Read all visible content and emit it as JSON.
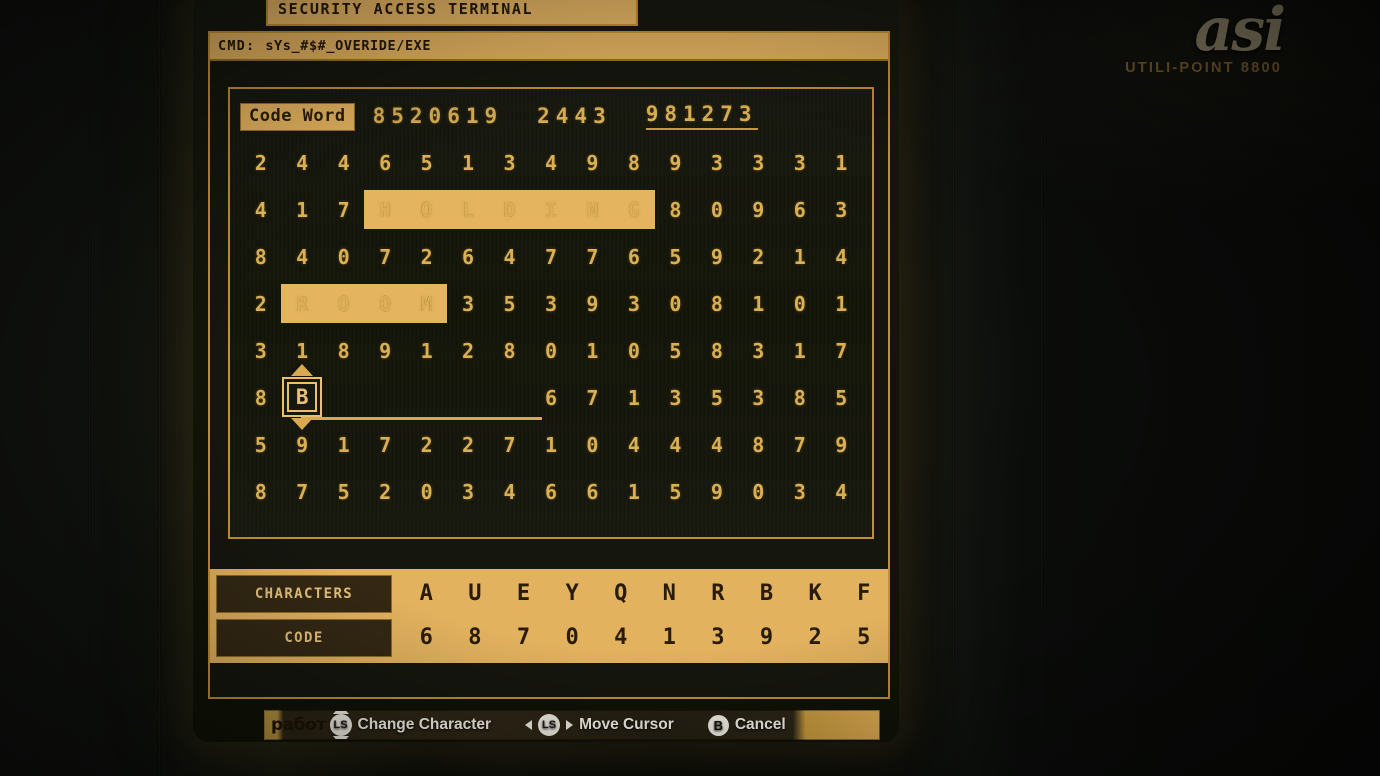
{
  "brand": {
    "mark": "asi",
    "sub": "UTILI-POINT 8800"
  },
  "top_banner": {
    "text": "SECURITY ACCESS TERMINAL"
  },
  "terminal": {
    "cmd_label": "CMD:",
    "cmd_value": "sYs_#$#_OVERIDE/EXE"
  },
  "codeword": {
    "label": "Code Word",
    "groups": [
      {
        "digits": "8520619",
        "underlined": false
      },
      {
        "digits": "2443",
        "underlined": false
      },
      {
        "digits": "981273",
        "underlined": true
      }
    ]
  },
  "grid": {
    "columns": 15,
    "rows": [
      {
        "cells": [
          "2",
          "4",
          "4",
          "6",
          "5",
          "1",
          "3",
          "4",
          "9",
          "8",
          "9",
          "3",
          "3",
          "3",
          "1"
        ]
      },
      {
        "cells": [
          "4",
          "1",
          "7",
          "H",
          "O",
          "L",
          "D",
          "I",
          "N",
          "G",
          "8",
          "0",
          "9",
          "6",
          "3"
        ],
        "highlight": {
          "word": "HOLDING",
          "start": 3,
          "length": 7
        }
      },
      {
        "cells": [
          "8",
          "4",
          "0",
          "7",
          "2",
          "6",
          "4",
          "7",
          "7",
          "6",
          "5",
          "9",
          "2",
          "1",
          "4"
        ]
      },
      {
        "cells": [
          "2",
          "R",
          "O",
          "O",
          "M",
          "3",
          "5",
          "3",
          "9",
          "3",
          "0",
          "8",
          "1",
          "0",
          "1"
        ],
        "highlight": {
          "word": "ROOM",
          "start": 1,
          "length": 4
        }
      },
      {
        "cells": [
          "3",
          "1",
          "8",
          "9",
          "1",
          "2",
          "8",
          "0",
          "1",
          "0",
          "5",
          "8",
          "3",
          "1",
          "7"
        ]
      },
      {
        "cells": [
          "8",
          "B",
          "",
          "",
          "",
          "",
          "",
          "6",
          "7",
          "1",
          "3",
          "5",
          "3",
          "8",
          "5"
        ],
        "cursor": {
          "index": 1,
          "char": "B"
        },
        "blank_underline": {
          "start": 1,
          "length": 6
        }
      },
      {
        "cells": [
          "5",
          "9",
          "1",
          "7",
          "2",
          "2",
          "7",
          "1",
          "0",
          "4",
          "4",
          "4",
          "8",
          "7",
          "9"
        ]
      },
      {
        "cells": [
          "8",
          "7",
          "5",
          "2",
          "0",
          "3",
          "4",
          "6",
          "6",
          "1",
          "5",
          "9",
          "0",
          "3",
          "4"
        ]
      }
    ]
  },
  "key_panel": {
    "characters_label": "CHARACTERS",
    "code_label": "CODE",
    "characters": [
      "A",
      "U",
      "E",
      "Y",
      "Q",
      "N",
      "R",
      "B",
      "K",
      "F"
    ],
    "codes": [
      "6",
      "8",
      "7",
      "0",
      "4",
      "1",
      "3",
      "9",
      "2",
      "5"
    ]
  },
  "hints": {
    "watermark": "работ",
    "items": [
      {
        "icon": "left-stick-vertical-icon",
        "glyph": "LS",
        "label": "Change Character"
      },
      {
        "icon": "left-stick-horizontal-icon",
        "glyph": "LS",
        "label": "Move Cursor"
      },
      {
        "icon": "b-button-icon",
        "glyph": "B",
        "label": "Cancel"
      }
    ]
  },
  "colors": {
    "amber": "#c4902f",
    "amber_light": "#e5b45f",
    "text_amber": "#dbb055",
    "dark": "#15160e",
    "dark_text": "#241a07"
  }
}
